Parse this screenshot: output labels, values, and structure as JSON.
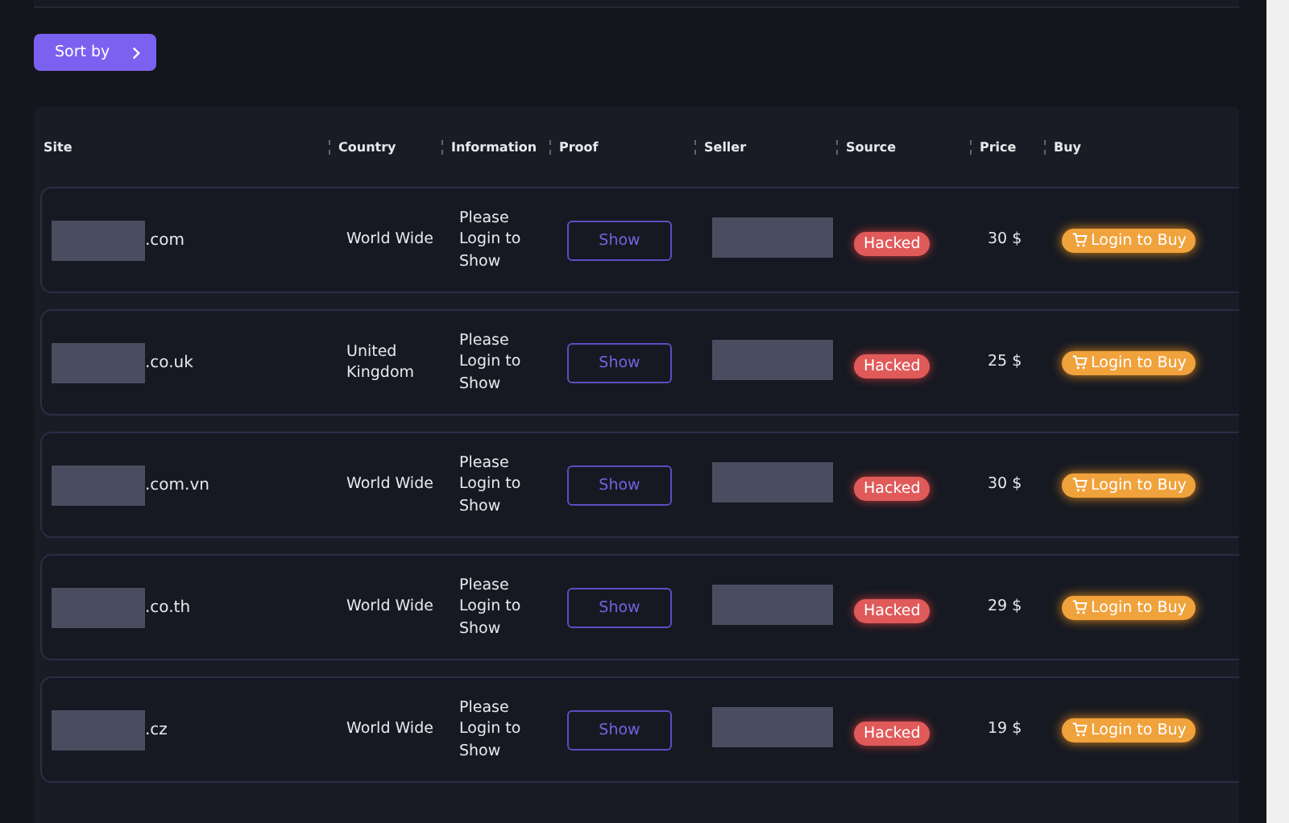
{
  "sort_button": {
    "label": "Sort by"
  },
  "table": {
    "columns": [
      "Site",
      "Country",
      "Information",
      "Proof",
      "Seller",
      "Source",
      "Price",
      "Buy"
    ],
    "rows": [
      {
        "site": ".com",
        "country": "World Wide",
        "information": "Please Login to Show",
        "proof": "Show",
        "source": "Hacked",
        "price": "30 $",
        "buy": "Login to Buy"
      },
      {
        "site": ".co.uk",
        "country": "United Kingdom",
        "information": "Please Login to Show",
        "proof": "Show",
        "source": "Hacked",
        "price": "25 $",
        "buy": "Login to Buy"
      },
      {
        "site": ".com.vn",
        "country": "World Wide",
        "information": "Please Login to Show",
        "proof": "Show",
        "source": "Hacked",
        "price": "30 $",
        "buy": "Login to Buy"
      },
      {
        "site": ".co.th",
        "country": "World Wide",
        "information": "Please Login to Show",
        "proof": "Show",
        "source": "Hacked",
        "price": "29 $",
        "buy": "Login to Buy"
      },
      {
        "site": ".cz",
        "country": "World Wide",
        "information": "Please Login to Show",
        "proof": "Show",
        "source": "Hacked",
        "price": "19 $",
        "buy": "Login to Buy"
      }
    ]
  }
}
